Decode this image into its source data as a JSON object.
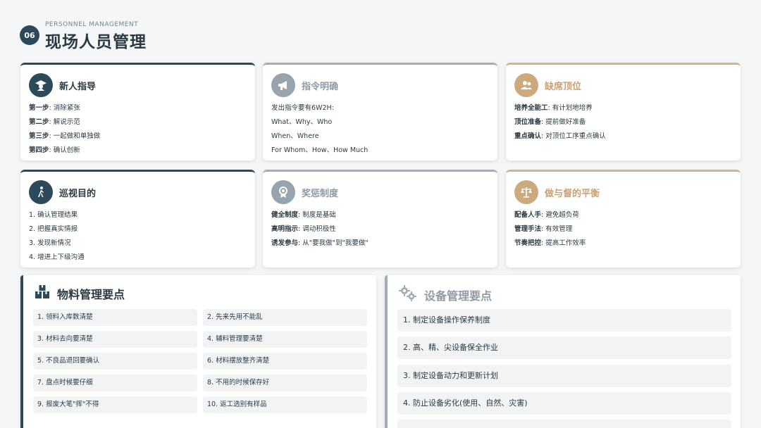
{
  "header": {
    "number": "06",
    "subtitle": "PERSONNEL MANAGEMENT",
    "title": "现场人员管理"
  },
  "cards": [
    {
      "title": "新人指导",
      "icon": "graduate-icon",
      "lines": [
        {
          "k": "第一步",
          "v": ": 消除紧张"
        },
        {
          "k": "第二步",
          "v": ": 解说示范"
        },
        {
          "k": "第三步",
          "v": ": 一起做和单独做"
        },
        {
          "k": "第四步",
          "v": ": 确认创新"
        }
      ]
    },
    {
      "title": "指令明确",
      "icon": "megaphone-icon",
      "lines": [
        {
          "k": "",
          "v": "发出指令要有6W2H:"
        },
        {
          "k": "",
          "v": "What、Why、Who"
        },
        {
          "k": "",
          "v": "When、Where"
        },
        {
          "k": "",
          "v": "For Whom、How、How Much"
        }
      ]
    },
    {
      "title": "缺席顶位",
      "icon": "users-icon",
      "lines": [
        {
          "k": "培养全能工",
          "v": ": 有计划地培养"
        },
        {
          "k": "顶位准备",
          "v": ": 提前做好准备"
        },
        {
          "k": "重点确认",
          "v": ": 对顶位工序重点确认"
        }
      ]
    },
    {
      "title": "巡视目的",
      "icon": "walking-icon",
      "lines": [
        {
          "k": "",
          "v": "1. 确认管理结果"
        },
        {
          "k": "",
          "v": "2. 把握真实情报"
        },
        {
          "k": "",
          "v": "3. 发现新情况"
        },
        {
          "k": "",
          "v": "4. 增进上下级沟通"
        }
      ]
    },
    {
      "title": "奖惩制度",
      "icon": "award-icon",
      "lines": [
        {
          "k": "健全制度",
          "v": ": 制度是基础"
        },
        {
          "k": "高明指示",
          "v": ": 调动积极性"
        },
        {
          "k": "诱发参与",
          "v": ": 从\"要我做\"到\"我要做\""
        }
      ]
    },
    {
      "title": "做与督的平衡",
      "icon": "balance-scale-icon",
      "lines": [
        {
          "k": "配备人手",
          "v": ": 避免超负荷"
        },
        {
          "k": "管理手法",
          "v": ": 有效管理"
        },
        {
          "k": "节奏把控",
          "v": ": 提高工作效率"
        }
      ]
    }
  ],
  "materials": {
    "title": "物料管理要点",
    "items": [
      "1. 领料入库数清楚",
      "2. 先来先用不能乱",
      "3. 材料去向要清楚",
      "4. 辅料管理要清楚",
      "5. 不良品退回要确认",
      "6. 材料摆放整齐清楚",
      "7. 盘点时候要仔细",
      "8. 不用的时候保存好",
      "9. 报废大笔\"挥\"不得",
      "10. 返工选别有样品"
    ]
  },
  "equipment": {
    "title": "设备管理要点",
    "items": [
      "1. 制定设备操作保养制度",
      "2. 高、精、尖设备保全作业",
      "3. 制定设备动力和更新计划",
      "4. 防止设备劣化(使用、自然、灾害)"
    ]
  }
}
